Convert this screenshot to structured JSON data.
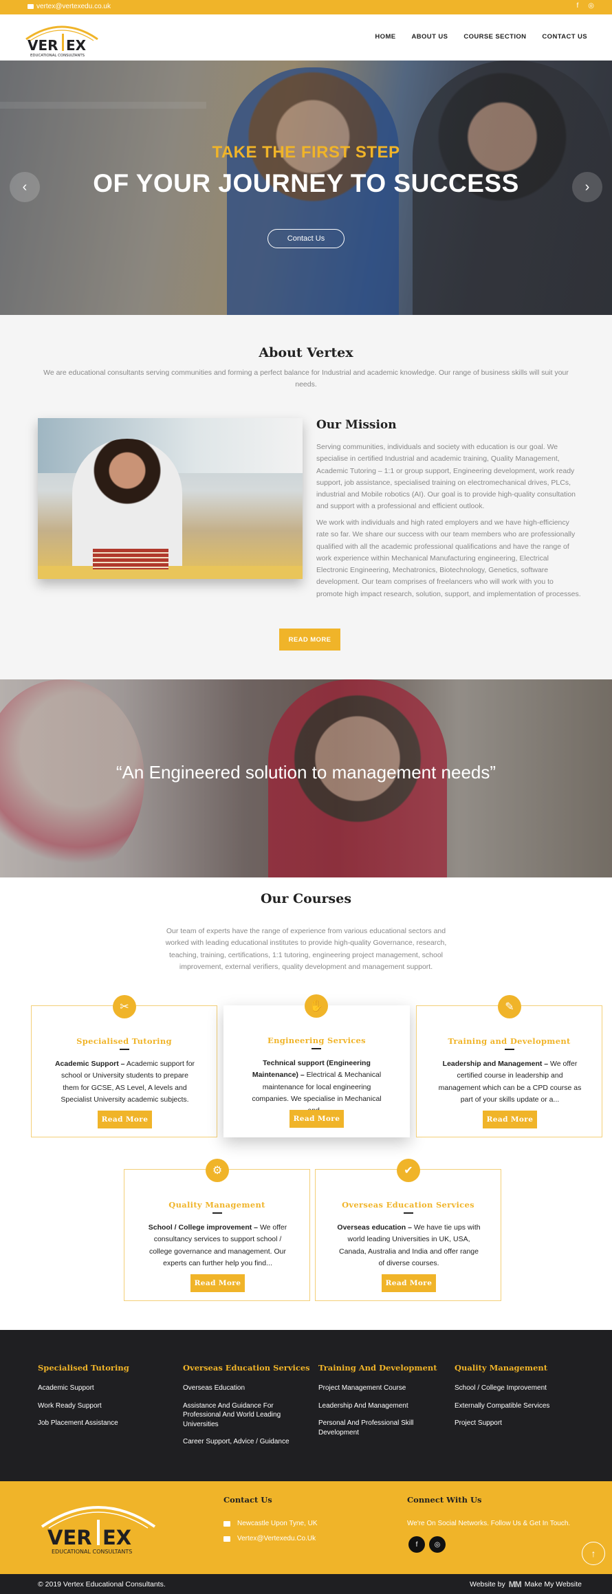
{
  "topbar": {
    "email": "vertex@vertexedu.co.uk",
    "social": [
      "f",
      "◎"
    ]
  },
  "brand": {
    "logo_word_left": "VER",
    "logo_word_right": "EX",
    "logo_tagline": "EDUCATIONAL CONSULTANTS"
  },
  "nav": [
    "HOME",
    "ABOUT US",
    "COURSE SECTION",
    "CONTACT US"
  ],
  "hero": {
    "subtitle": "TAKE THE FIRST STEP",
    "title": "OF YOUR JOURNEY TO SUCCESS",
    "button": "Contact Us",
    "prev": "‹",
    "next": "›"
  },
  "about": {
    "heading": "About Vertex",
    "lead": "We are educational consultants serving communities and forming a perfect balance for Industrial and academic knowledge. Our range of business skills will suit your needs.",
    "mission_heading": "Our Mission",
    "mission_p1": "Serving communities, individuals and society with education is our goal. We specialise in certified Industrial and academic training, Quality Management, Academic Tutoring – 1:1 or group support, Engineering development, work ready support, job assistance, specialised training on electromechanical drives, PLCs, industrial and Mobile robotics (AI). Our goal is to provide high-quality consultation and support with a professional and efficient outlook.",
    "mission_p2": "We work with individuals and high rated employers and we have high-efficiency rate so far. We share our success with our team members who are professionally qualified with all the academic professional qualifications and have the range of work experience within Mechanical Manufacturing engineering, Electrical Electronic Engineering, Mechatronics, Biotechnology, Genetics, software development. Our team comprises of freelancers who will work with you to promote high impact research, solution, support, and implementation of processes.",
    "button": "READ MORE"
  },
  "quote": {
    "text": "“An Engineered solution to management needs”"
  },
  "courses": {
    "heading": "Our Courses",
    "lead": "Our team of experts have the range of experience from various educational sectors and worked with leading educational institutes to provide high-quality Governance, research, teaching, training, certifications, 1:1 tutoring, engineering project management, school improvement, external verifiers, quality development and management support.",
    "cards": [
      {
        "icon": "✂",
        "title": "Specialised Tutoring",
        "lead": "Academic Support –",
        "text": " Academic support for school or University students to prepare them for GCSE, AS Level, A levels and Specialist University academic subjects.",
        "button": "Read More"
      },
      {
        "icon": "✋",
        "title": "Engineering Services",
        "lead": "Technical support (Engineering Maintenance) –",
        "text": " Electrical & Mechanical maintenance for local engineering companies. We specialise in Mechanical and...",
        "button": "Read More"
      },
      {
        "icon": "✎",
        "title": "Training and Development",
        "lead": "Leadership and Management –",
        "text": " We offer certified course in leadership and management which can be a CPD course as part of your skills update or a...",
        "button": "Read More"
      },
      {
        "icon": "⚙",
        "title": "Quality Management",
        "lead": "School / College improvement –",
        "text": " We offer consultancy services to support school / college governance and management. Our experts can further help you find...",
        "button": "Read More"
      },
      {
        "icon": "✔",
        "title": "Overseas Education Services",
        "lead": "Overseas education –",
        "text": " We have tie ups with world leading Universities in UK, USA, Canada, Australia and India and offer range of diverse courses.",
        "button": "Read More"
      }
    ]
  },
  "footer": {
    "columns": [
      {
        "heading": "Specialised Tutoring",
        "links": [
          "Academic Support",
          "Work Ready Support",
          "Job Placement Assistance"
        ]
      },
      {
        "heading": "Overseas Education Services",
        "links": [
          "Overseas Education",
          "Assistance And Guidance For Professional And World Leading Universities",
          "Career Support, Advice / Guidance"
        ]
      },
      {
        "heading": "Training And Development",
        "links": [
          "Project Management Course",
          "Leadership And Management",
          "Personal And Professional Skill Development"
        ]
      },
      {
        "heading": "Quality Management",
        "links": [
          "School / College Improvement",
          "Externally Compatible Services",
          "Project Support"
        ]
      }
    ],
    "contact_heading": "Contact Us",
    "address": "Newcastle Upon Tyne, UK",
    "email": "Vertex@Vertexedu.Co.Uk",
    "connect_heading": "Connect With Us",
    "connect_text": "We're On Social Networks. Follow Us & Get In Touch.",
    "social": [
      "f",
      "◎"
    ],
    "to_top": "↑",
    "copyright": "© 2019 Vertex Educational Consultants.",
    "credit_prefix": "Website by",
    "credit_logo": "MM",
    "credit_name": "Make My Website"
  },
  "colors": {
    "accent": "#f0b429",
    "dark": "#1f1f22"
  }
}
